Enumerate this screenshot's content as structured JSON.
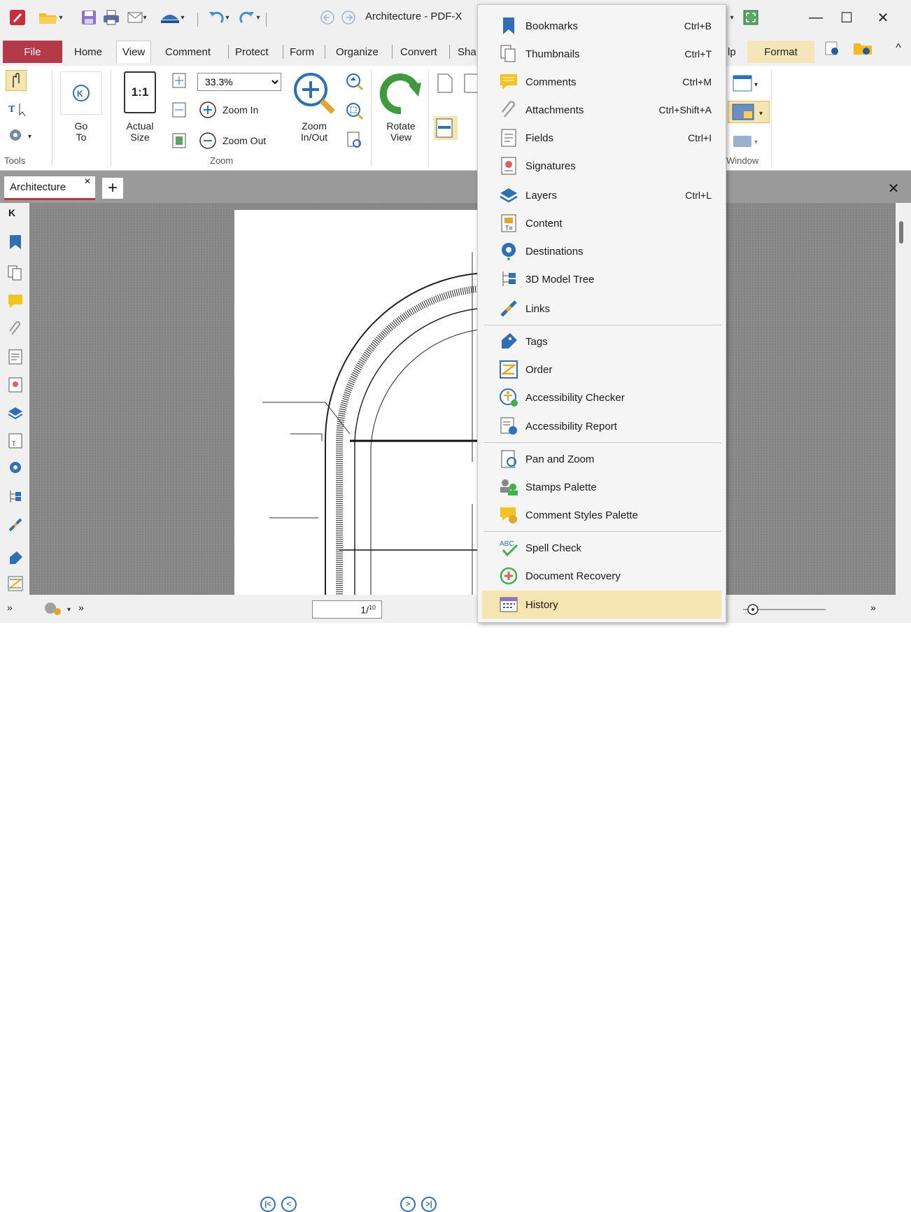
{
  "titlebar": {
    "title": "Architecture - PDF-X"
  },
  "tabs": {
    "file": "File",
    "items": [
      "Home",
      "View",
      "Comment",
      "Protect",
      "Form",
      "Organize",
      "Convert",
      "Sha"
    ],
    "right_partial": "lp",
    "format": "Format"
  },
  "ribbon": {
    "tools_label": "Tools",
    "goto_label": "Go\nTo",
    "goto_line1": "Go",
    "goto_line2": "To",
    "actual_line1": "Actual",
    "actual_line2": "Size",
    "one_to_one": "1:1",
    "zoom_value": "33.3%",
    "zoom_in": "Zoom In",
    "zoom_out": "Zoom Out",
    "zoom_inout_line1": "Zoom",
    "zoom_inout_line2": "In/Out",
    "zoom_group": "Zoom",
    "rotate_line1": "Rotate",
    "rotate_line2": "View",
    "window_group": "Window"
  },
  "document": {
    "tab_label": "Architecture",
    "page_current": "1",
    "page_total": "10"
  },
  "menu": {
    "items": [
      {
        "label": "Bookmarks",
        "shortcut": "Ctrl+B",
        "icon": "bookmark-icon"
      },
      {
        "label": "Thumbnails",
        "shortcut": "Ctrl+T",
        "icon": "thumbnails-icon"
      },
      {
        "label": "Comments",
        "shortcut": "Ctrl+M",
        "icon": "comments-icon"
      },
      {
        "label": "Attachments",
        "shortcut": "Ctrl+Shift+A",
        "icon": "paperclip-icon"
      },
      {
        "label": "Fields",
        "shortcut": "Ctrl+I",
        "icon": "fields-icon"
      },
      {
        "label": "Signatures",
        "shortcut": "",
        "icon": "signature-icon"
      },
      {
        "label": "Layers",
        "shortcut": "Ctrl+L",
        "icon": "layers-icon"
      },
      {
        "label": "Content",
        "shortcut": "",
        "icon": "content-icon"
      },
      {
        "label": "Destinations",
        "shortcut": "",
        "icon": "destinations-icon"
      },
      {
        "label": "3D Model Tree",
        "shortcut": "",
        "icon": "model-tree-icon"
      },
      {
        "label": "Links",
        "shortcut": "",
        "icon": "link-icon"
      },
      {
        "label": "Tags",
        "shortcut": "",
        "icon": "tag-icon"
      },
      {
        "label": "Order",
        "shortcut": "",
        "icon": "order-icon"
      },
      {
        "label": "Accessibility Checker",
        "shortcut": "",
        "icon": "accessibility-icon"
      },
      {
        "label": "Accessibility Report",
        "shortcut": "",
        "icon": "accessibility-report-icon"
      },
      {
        "label": "Pan and Zoom",
        "shortcut": "",
        "icon": "pan-zoom-icon"
      },
      {
        "label": "Stamps Palette",
        "shortcut": "",
        "icon": "stamps-icon"
      },
      {
        "label": "Comment Styles Palette",
        "shortcut": "",
        "icon": "comment-styles-icon"
      },
      {
        "label": "Spell Check",
        "shortcut": "",
        "icon": "spell-check-icon"
      },
      {
        "label": "Document Recovery",
        "shortcut": "",
        "icon": "recovery-icon"
      },
      {
        "label": "History",
        "shortcut": "",
        "icon": "history-icon"
      }
    ],
    "spell_abc": "ABC"
  },
  "colors": {
    "file_tab": "#b43a4a",
    "accent_blue": "#2e6fb5",
    "highlight": "#f5e5b0"
  }
}
